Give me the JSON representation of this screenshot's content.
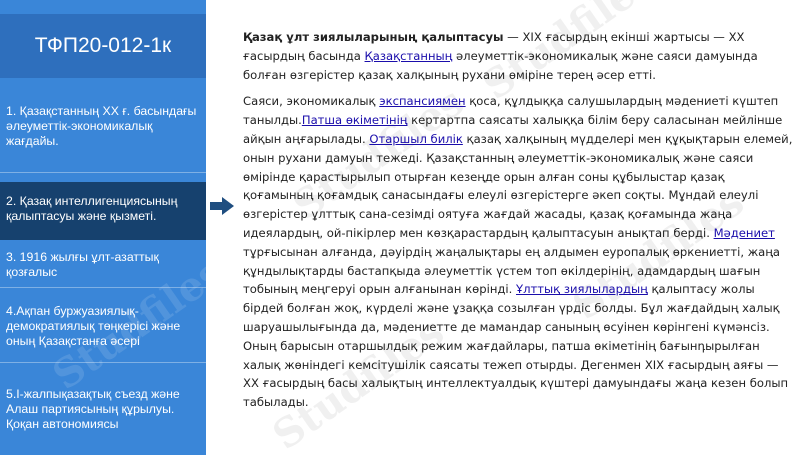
{
  "sidebar": {
    "title": "ТФП20-012-1к",
    "items": [
      {
        "label": "1. Қазақстанның ХХ ғ. басындағы әлеуметтік-экономикалық жағдайы."
      },
      {
        "label": "2. Қазақ интеллигенциясының қалыптасуы және қызметі."
      },
      {
        "label": "3. 1916 жылғы ұлт-азаттық қозғалыс"
      },
      {
        "label": "4.Ақпан буржуазиялық-демократиялық төңкерісі және оның Қазақстанға әсері"
      },
      {
        "label": "5.І-жалпықазақтық съезд және Алаш партиясының құрылуы. Қоқан автономиясы"
      }
    ],
    "active_index": 1,
    "colors": {
      "panel": "#3a86d8",
      "title_bg": "#2e6fbd",
      "active_bg": "#16416e",
      "arrow": "#1f4e80"
    }
  },
  "watermark": {
    "text": "Studfiles"
  },
  "content": {
    "p1": {
      "bold": "Қазақ ұлт зиялыларының қалыптасуы",
      "t1": " — XIX ғасырдың екінші жартысы — XX ғасырдың басында ",
      "link1": "Қазақстанның",
      "t2": " әлеуметтік-экономикалық және саяси дамуында болған өзгерістер қазақ халқының рухани өміріне терең әсер етті."
    },
    "p2": {
      "t1": "Саяси, экономикалық ",
      "link1": "экспансиямен",
      "t2": " қоса, құлдыққа салушылардың мәдениеті күштеп танылды.",
      "link2": "Патша өкіметінің",
      "t3": " кертартпа саясаты халыққа білім беру саласынан мейлінше айқын аңғарылады. ",
      "link3": "Отаршыл билік",
      "t4": " қазақ халқының мүдделері мен құқықтарын елемей, онын рухани дамуын тежеді. Қазақстанның әлеуметтік-экономикалық және саяси өмірінде қарастырылып отырған кезеңде орын алған соны құбылыстар қазақ қоғамының қоғамдық санасындағы елеулі өзгерістерге әкеп соқты. Мұндай елеулі өзгерістер ұлттық сана-сезімді оятуға жағдай жасады, қазақ қоғамында жаңа идеялардың, ой-пікірлер мен көзқарастардың қалыптасуын анықтап берді. ",
      "link4": "Мәдениет",
      "t5": " тұрғысынан алғанда, дәуірдің жаңалықтары ең алдымен еуропалық өркениетті, жаңа құндылықтарды бастапқыда әлеуметтік үстем топ өкілдерінің, адамдардың шағын тобының меңгеруі орын алғанынан көрінді. ",
      "link5": "Ұлттық зиялылардың",
      "t6": " қалыптасу жолы бірдей болған жоқ, күрделі және ұзаққа созылған үрдіс болды. Бұл жағдайдың халық шаруашылығында да, мәдениетте де мамандар санының өсуінен көрінгені күмәнсіз. Оның барысын отаршылдық режим жағдайлары, патша өкіметінің бағынդырылған халық жөніндегі кемсітушілік саясаты тежеп отырды. Дегенмен XIX ғасырдың аяғы — XX ғасырдың басы халықтың интеллектуалдық күштері дамуындағы жаңа кезен болып табылады."
    }
  }
}
